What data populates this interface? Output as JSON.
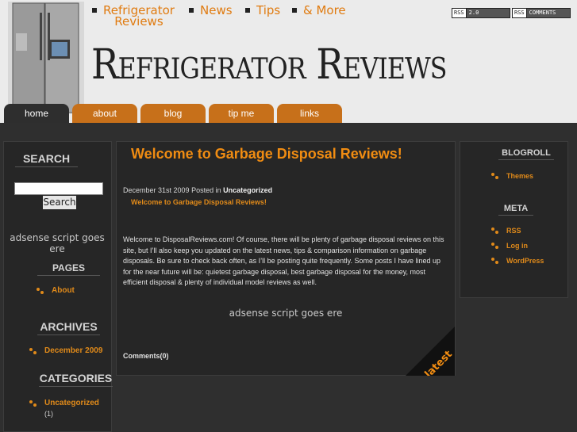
{
  "header": {
    "site_title": "Refrigerator Reviews",
    "topnav": [
      {
        "label": "Refrigerator\nReviews"
      },
      {
        "label": "News"
      },
      {
        "label": "Tips"
      },
      {
        "label": "& More"
      }
    ],
    "rss_badges": [
      {
        "left": "RSS",
        "right": "2.0"
      },
      {
        "left": "RSS",
        "right": "COMMENTS"
      }
    ]
  },
  "tabs": [
    {
      "label": "home",
      "active": true
    },
    {
      "label": "about"
    },
    {
      "label": "blog"
    },
    {
      "label": "tip me"
    },
    {
      "label": "links"
    }
  ],
  "left_sidebar": {
    "search_heading": "SEARCH",
    "search_button": "Search",
    "adsense": "adsense script goes ere",
    "pages_heading": "PAGES",
    "pages": [
      {
        "label": "About"
      }
    ],
    "archives_heading": "ARCHIVES",
    "archives": [
      {
        "label": "December 2009"
      }
    ],
    "categories_heading": "CATEGORIES",
    "categories": [
      {
        "label": "Uncategorized",
        "count": "(1)"
      }
    ]
  },
  "post": {
    "title": "Welcome to Garbage Disposal Reviews!",
    "date": "December 31st 2009",
    "posted_in": "Posted in",
    "category": "Uncategorized",
    "subtitle": "Welcome to Garbage Disposal Reviews!",
    "body": "Welcome to DisposalReviews.com! Of course, there will be plenty of garbage disposal reviews on this site, but I’ll also keep you updated on the latest news, tips & comparison information on garbage disposals. Be sure to check back often, as I’ll be posting quite frequently. Some posts I have lined up for the near future will be: quietest garbage disposal, best garbage disposal for the money, most efficient disposal & plenty of individual model reviews as well.",
    "adsense": "adsense script goes ere",
    "comments": "Comments(0)",
    "badge": "latest"
  },
  "right_sidebar": {
    "blogroll_heading": "BLOGROLL",
    "blogroll": [
      {
        "label": "Themes"
      }
    ],
    "meta_heading": "META",
    "meta": [
      {
        "label": "RSS"
      },
      {
        "label": "Log in"
      },
      {
        "label": "WordPress"
      }
    ]
  },
  "colors": {
    "accent": "#e08a1a",
    "tab": "#c7701a",
    "background": "#2f2f2f"
  }
}
